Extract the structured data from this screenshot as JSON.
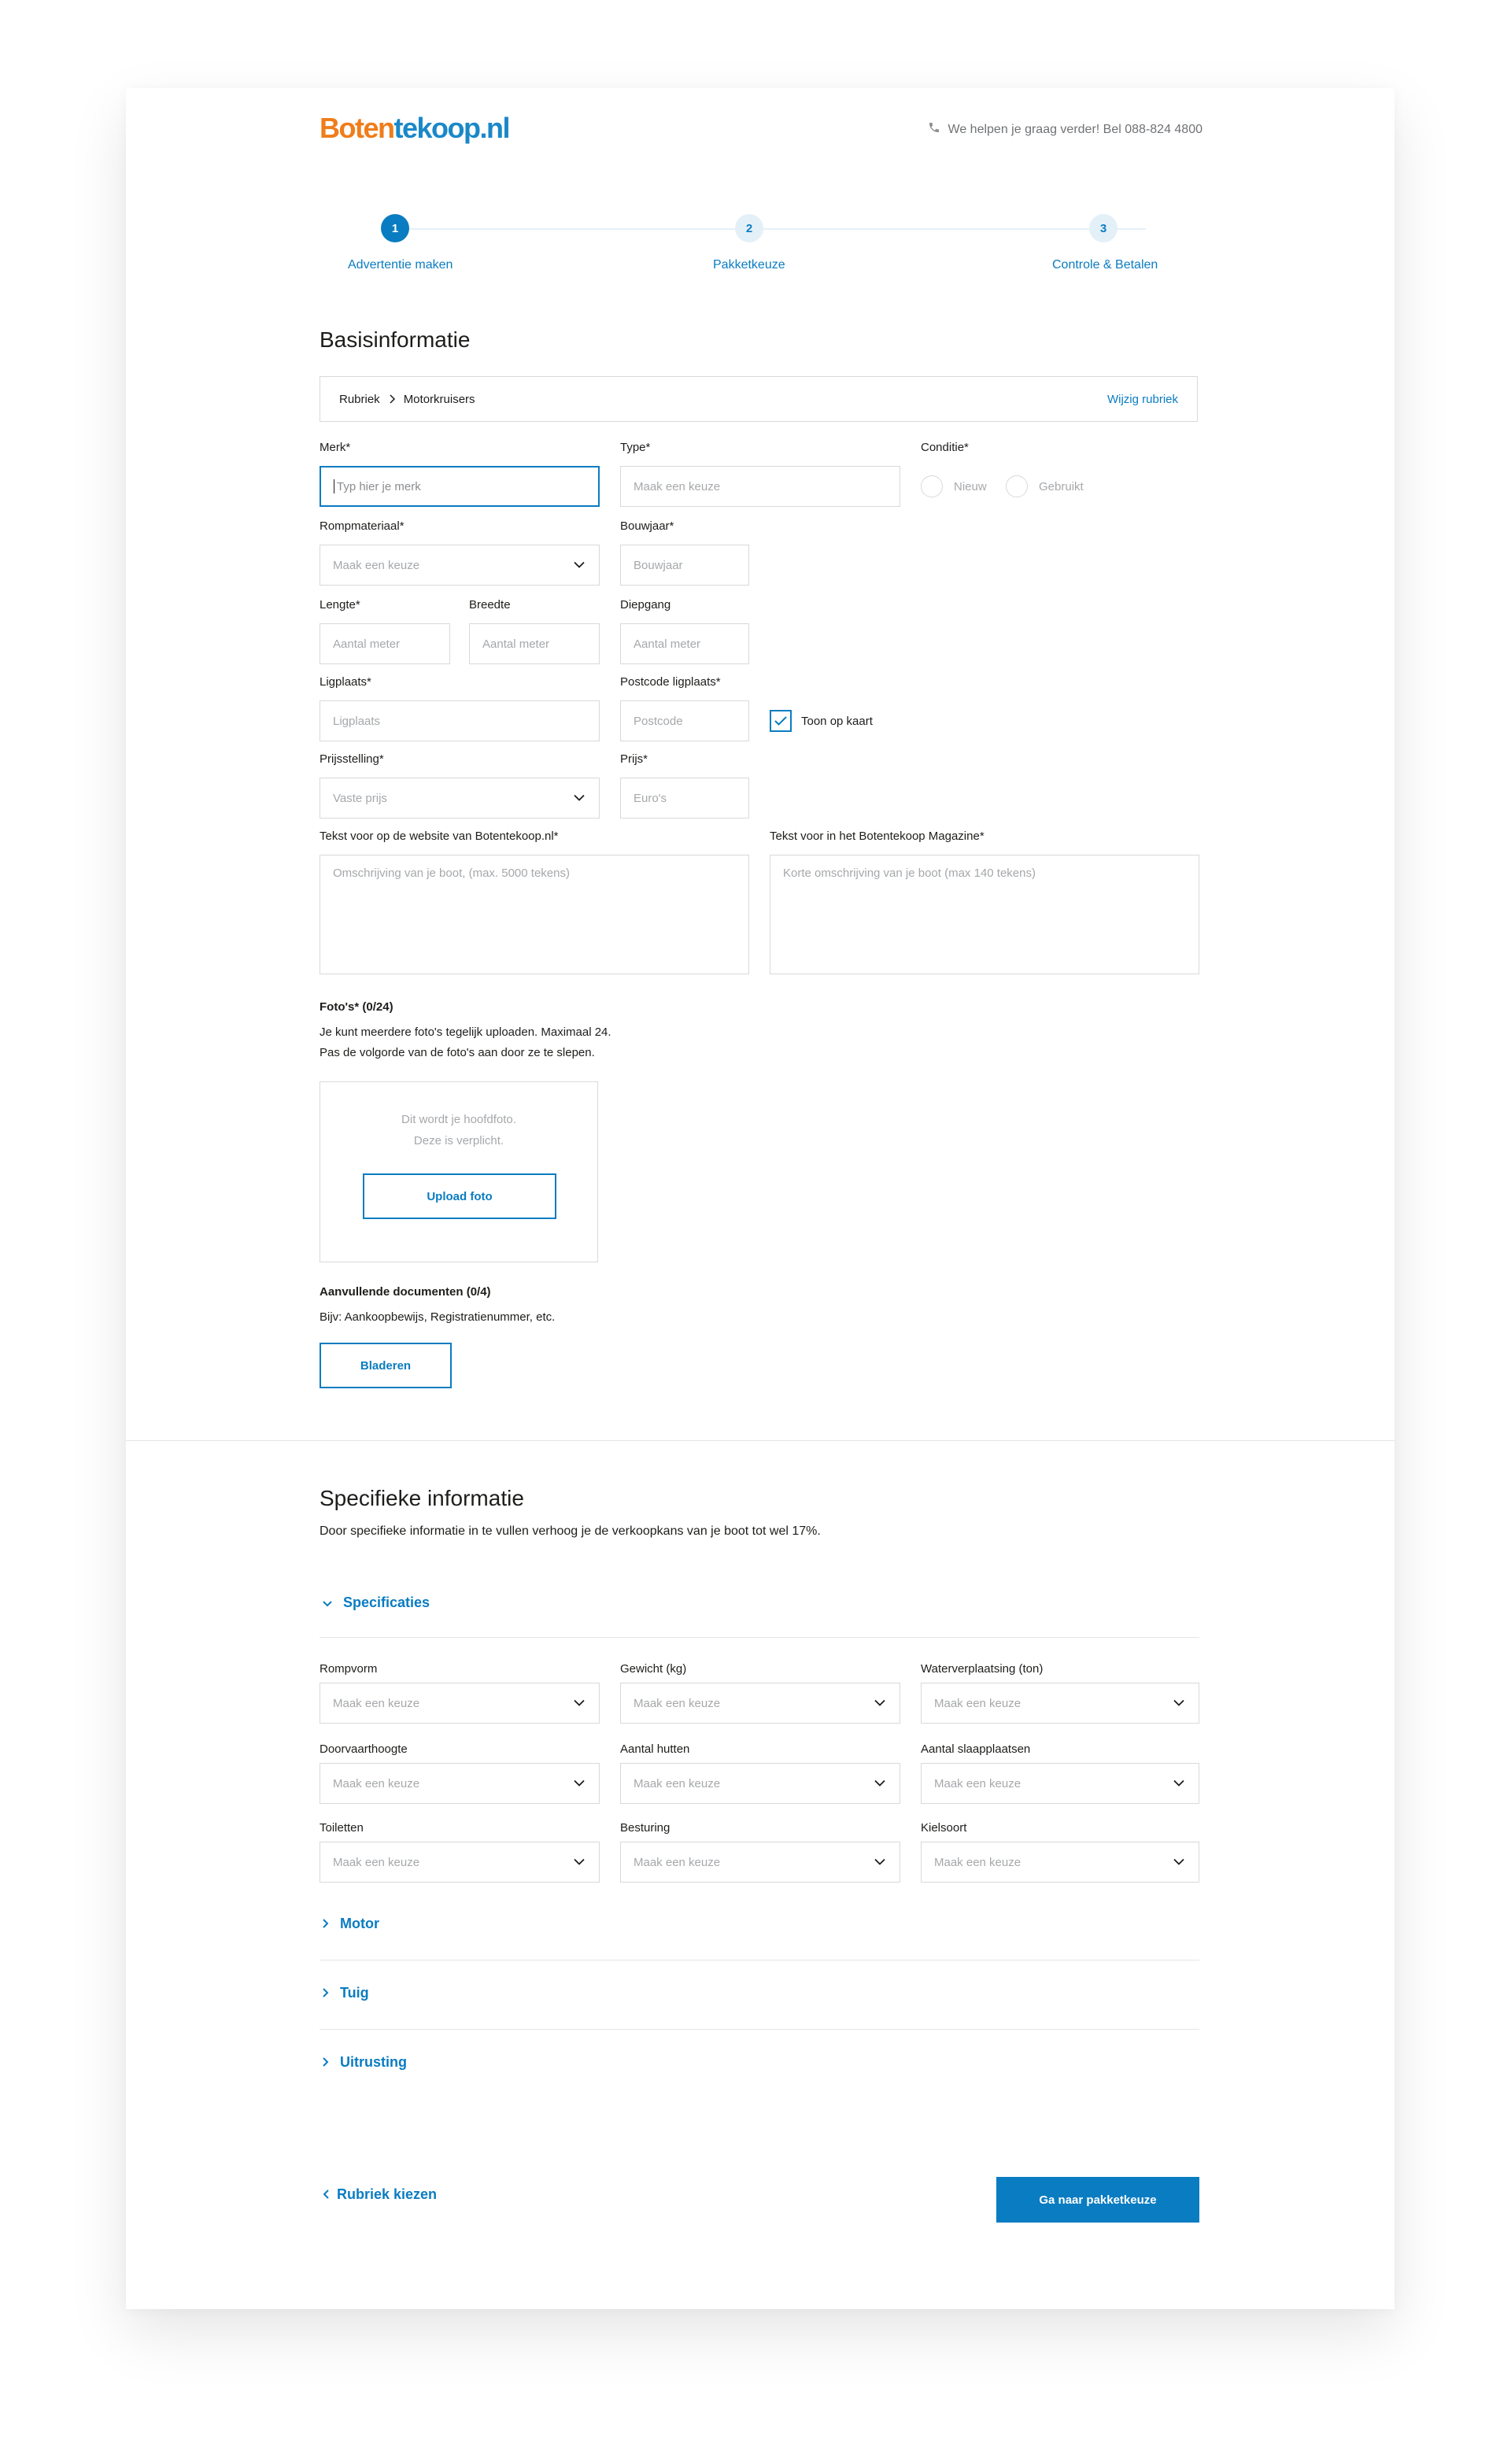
{
  "header": {
    "logo_part1": "Boten",
    "logo_part2": "tekoop.nl",
    "help_text": "We helpen je graag verder! Bel 088-824 4800",
    "help_icon": "phone-icon"
  },
  "steps": [
    {
      "number": "1",
      "label": "Advertentie maken",
      "active": true
    },
    {
      "number": "2",
      "label": "Pakketkeuze",
      "active": false
    },
    {
      "number": "3",
      "label": "Controle & Betalen",
      "active": false
    }
  ],
  "basic": {
    "title": "Basisinformatie",
    "breadcrumb": {
      "root": "Rubriek",
      "current": "Motorkruisers",
      "change_link": "Wijzig rubriek"
    },
    "merk": {
      "label": "Merk*",
      "placeholder": "Typ hier je merk"
    },
    "type": {
      "label": "Type*",
      "placeholder": "Maak een keuze"
    },
    "conditie": {
      "label": "Conditie*",
      "option_new": "Nieuw",
      "option_used": "Gebruikt"
    },
    "rompmateriaal": {
      "label": "Rompmateriaal*",
      "placeholder": "Maak een keuze"
    },
    "bouwjaar": {
      "label": "Bouwjaar*",
      "placeholder": "Bouwjaar"
    },
    "lengte": {
      "label": "Lengte*",
      "placeholder": "Aantal meter"
    },
    "breedte": {
      "label": "Breedte",
      "placeholder": "Aantal meter"
    },
    "diepgang": {
      "label": "Diepgang",
      "placeholder": "Aantal meter"
    },
    "ligplaats": {
      "label": "Ligplaats*",
      "placeholder": "Ligplaats"
    },
    "postcode": {
      "label": "Postcode ligplaats*",
      "placeholder": "Postcode"
    },
    "toon_op_kaart": {
      "label": "Toon op kaart",
      "checked": true
    },
    "prijsstelling": {
      "label": "Prijsstelling*",
      "value": "Vaste prijs"
    },
    "prijs": {
      "label": "Prijs*",
      "placeholder": "Euro's"
    },
    "website_text": {
      "label": "Tekst voor op de website van Botentekoop.nl*",
      "placeholder": "Omschrijving van je boot, (max. 5000 tekens)"
    },
    "magazine_text": {
      "label": "Tekst voor in het Botentekoop Magazine*",
      "placeholder": "Korte omschrijving van je boot (max 140 tekens)"
    },
    "photos": {
      "title": "Foto's* (0/24)",
      "line1": "Je kunt meerdere foto's tegelijk uploaden. Maximaal 24.",
      "line2": "Pas de volgorde van de foto's aan door ze te slepen.",
      "hint1": "Dit wordt je hoofdfoto.",
      "hint2": "Deze is verplicht.",
      "upload_button": "Upload foto"
    },
    "documents": {
      "title": "Aanvullende documenten (0/4)",
      "description": "Bijv: Aankoopbewijs, Registratienummer, etc.",
      "browse_button": "Bladeren"
    }
  },
  "specific": {
    "title": "Specifieke informatie",
    "subtitle": "Door specifieke informatie in te vullen verhoog je de verkoopkans van je boot tot wel 17%.",
    "sections": {
      "specificaties": "Specificaties",
      "motor": "Motor",
      "tuig": "Tuig",
      "uitrusting": "Uitrusting"
    },
    "fields": [
      {
        "label": "Rompvorm",
        "placeholder": "Maak een keuze"
      },
      {
        "label": "Gewicht (kg)",
        "placeholder": "Maak een keuze"
      },
      {
        "label": "Waterverplaatsing (ton)",
        "placeholder": "Maak een keuze"
      },
      {
        "label": "Doorvaarthoogte",
        "placeholder": "Maak een keuze"
      },
      {
        "label": "Aantal hutten",
        "placeholder": "Maak een keuze"
      },
      {
        "label": "Aantal slaapplaatsen",
        "placeholder": "Maak een keuze"
      },
      {
        "label": "Toiletten",
        "placeholder": "Maak een keuze"
      },
      {
        "label": "Besturing",
        "placeholder": "Maak een keuze"
      },
      {
        "label": "Kielsoort",
        "placeholder": "Maak een keuze"
      }
    ]
  },
  "footer": {
    "back_link": "Rubriek kiezen",
    "next_button": "Ga naar pakketkeuze"
  },
  "colors": {
    "accent": "#0a7cc1",
    "logo_orange": "#ef7d1a",
    "logo_blue": "#1a88c8"
  }
}
